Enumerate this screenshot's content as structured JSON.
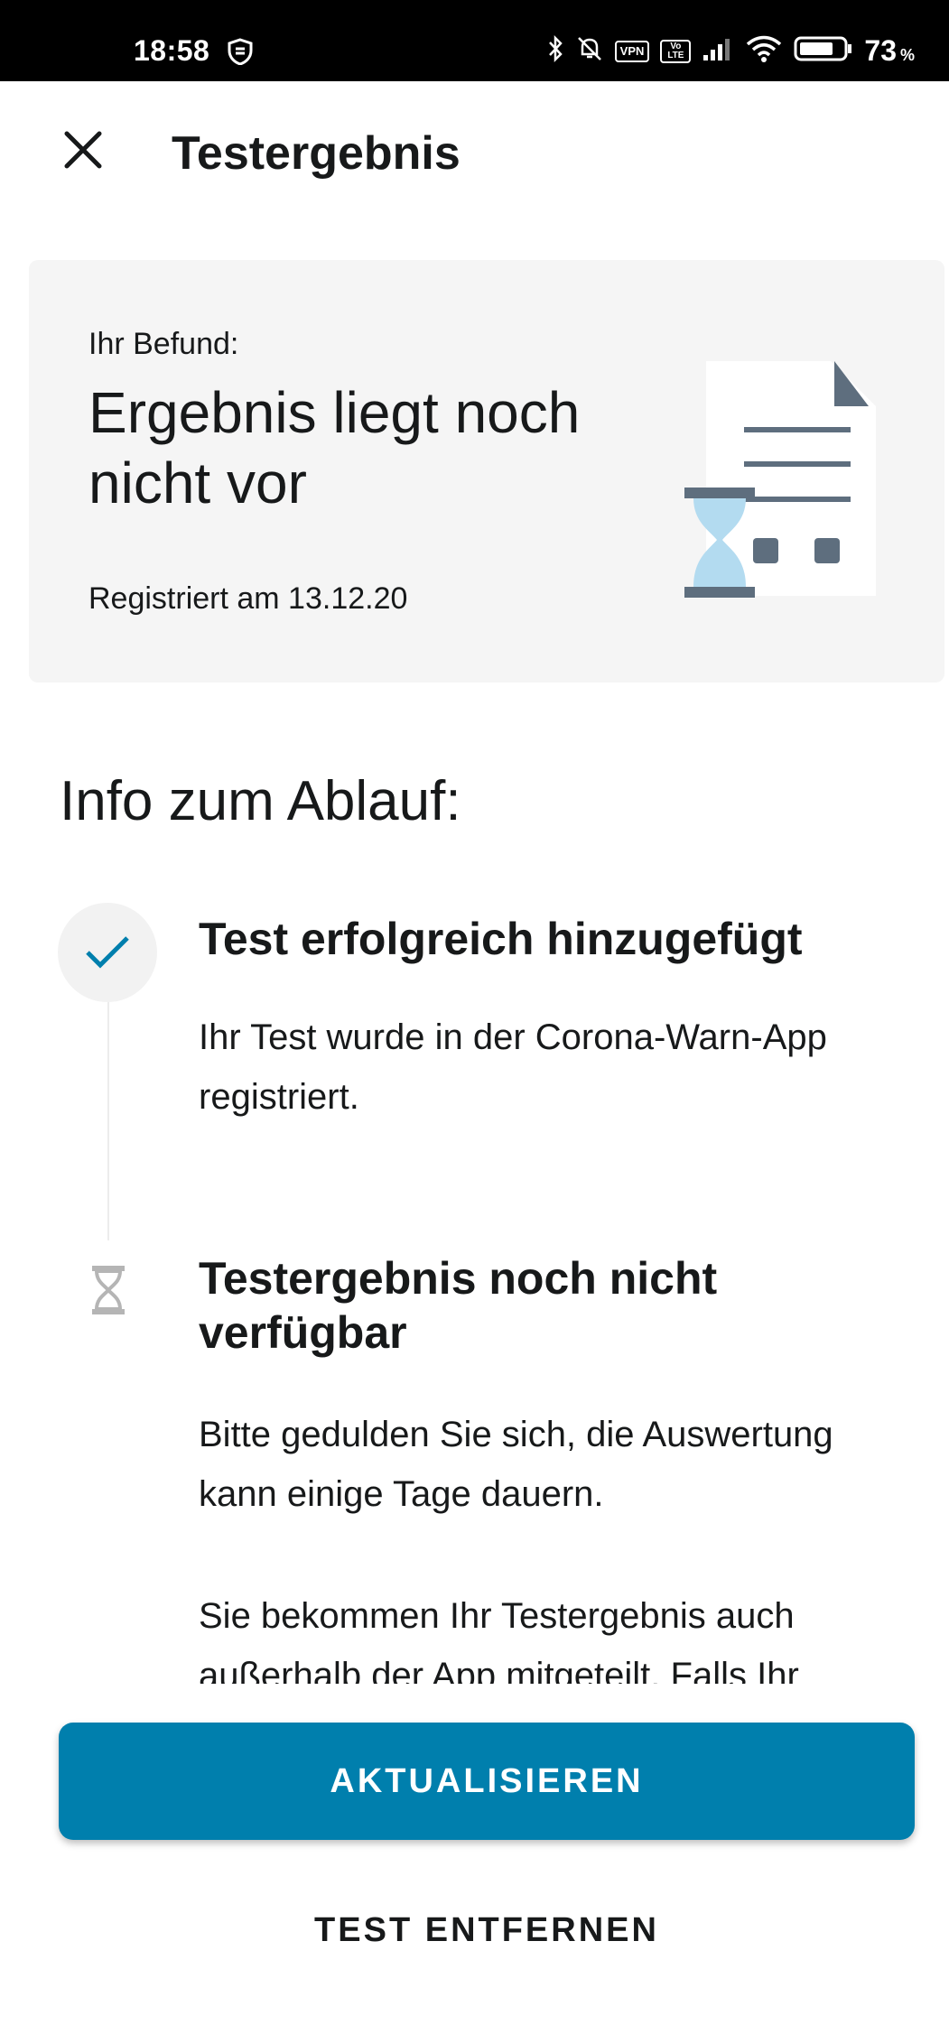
{
  "status_bar": {
    "time": "18:58",
    "vpn_label": "VPN",
    "volte_label": "Vo LTE",
    "battery_percent": "73",
    "percent_sign": "%",
    "icons": [
      "shield-icon",
      "bluetooth-icon",
      "bell-off-icon",
      "vpn-icon",
      "volte-icon",
      "signal-icon",
      "wifi-icon",
      "battery-icon"
    ]
  },
  "app_bar": {
    "title": "Testergebnis",
    "close_icon": "close-icon"
  },
  "result_card": {
    "label": "Ihr Befund:",
    "status": "Ergebnis liegt noch nicht vor",
    "registered": "Registriert am 13.12.20",
    "illustration": "document-hourglass-illustration"
  },
  "info": {
    "heading": "Info zum Ablauf:",
    "steps": [
      {
        "icon": "check-icon",
        "title": "Test erfolgreich hinzugefügt",
        "text": "Ihr Test wurde in der Corona-Warn-App registriert."
      },
      {
        "icon": "hourglass-icon",
        "title": "Testergebnis noch nicht verfügbar",
        "text": "Bitte gedulden Sie sich, die Auswertung kann einige Tage dauern.",
        "text_2": "Sie bekommen Ihr Testergebnis auch außerhalb der App mitgeteilt. Falls Ihr"
      }
    ]
  },
  "buttons": {
    "primary": "AKTUALISIEREN",
    "secondary": "TEST ENTFERNEN"
  },
  "colors": {
    "accent": "#007fad",
    "card_background": "#f5f5f5",
    "hourglass_sand": "#b3dbf0",
    "icon_gray": "#5e6e7e"
  }
}
